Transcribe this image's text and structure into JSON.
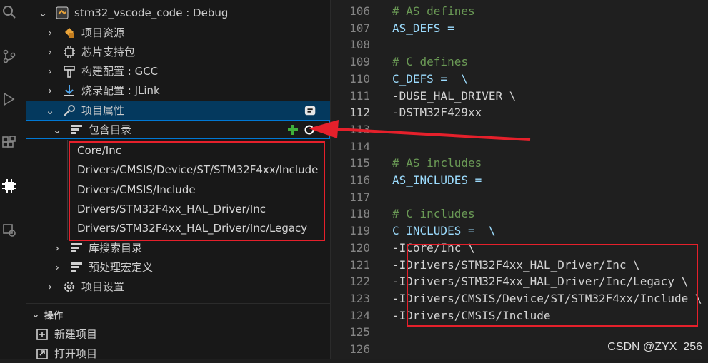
{
  "tree": {
    "project": "stm32_vscode_code : Debug",
    "items": [
      {
        "label": "项目资源",
        "icon": "resources-icon"
      },
      {
        "label": "芯片支持包",
        "icon": "chip-icon"
      },
      {
        "label": "构建配置 : GCC",
        "icon": "build-icon"
      },
      {
        "label": "烧录配置 : JLink",
        "icon": "download-icon"
      },
      {
        "label": "项目属性",
        "icon": "wrench-icon"
      }
    ],
    "include_dirs_label": "包含目录",
    "include_dirs": [
      "Core/Inc",
      "Drivers/CMSIS/Device/ST/STM32F4xx/Include",
      "Drivers/CMSIS/Include",
      "Drivers/STM32F4xx_HAL_Driver/Inc",
      "Drivers/STM32F4xx_HAL_Driver/Inc/Legacy"
    ],
    "lib_search_label": "库搜索目录",
    "preprocessor_label": "预处理宏定义",
    "project_settings_label": "项目设置"
  },
  "actions": {
    "title": "操作",
    "new_project": "新建项目",
    "open_project": "打开项目"
  },
  "editor": {
    "current_line": 112,
    "lines": [
      {
        "n": "106",
        "text": "# AS defines",
        "kind": "comment"
      },
      {
        "n": "107",
        "text": "AS_DEFS =",
        "kind": "var"
      },
      {
        "n": "108",
        "text": "",
        "kind": "plain"
      },
      {
        "n": "109",
        "text": "# C defines",
        "kind": "comment"
      },
      {
        "n": "110",
        "text": "C_DEFS =  \\",
        "kind": "var"
      },
      {
        "n": "111",
        "text": "-DUSE_HAL_DRIVER \\",
        "kind": "plain"
      },
      {
        "n": "112",
        "text": "-DSTM32F429xx",
        "kind": "plain"
      },
      {
        "n": "113",
        "text": "",
        "kind": "plain"
      },
      {
        "n": "114",
        "text": "",
        "kind": "plain"
      },
      {
        "n": "115",
        "text": "# AS includes",
        "kind": "comment"
      },
      {
        "n": "116",
        "text": "AS_INCLUDES =",
        "kind": "var"
      },
      {
        "n": "117",
        "text": "",
        "kind": "plain"
      },
      {
        "n": "118",
        "text": "# C includes",
        "kind": "comment"
      },
      {
        "n": "119",
        "text": "C_INCLUDES =  \\",
        "kind": "var"
      },
      {
        "n": "120",
        "text": "-ICore/Inc \\",
        "kind": "plain"
      },
      {
        "n": "121",
        "text": "-IDrivers/STM32F4xx_HAL_Driver/Inc \\",
        "kind": "plain"
      },
      {
        "n": "122",
        "text": "-IDrivers/STM32F4xx_HAL_Driver/Inc/Legacy \\",
        "kind": "plain"
      },
      {
        "n": "123",
        "text": "-IDrivers/CMSIS/Device/ST/STM32F4xx/Include \\",
        "kind": "plain"
      },
      {
        "n": "124",
        "text": "-IDrivers/CMSIS/Include",
        "kind": "plain"
      },
      {
        "n": "125",
        "text": "",
        "kind": "plain"
      },
      {
        "n": "126",
        "text": "",
        "kind": "plain"
      }
    ]
  },
  "watermark": "CSDN @ZYX_256",
  "colors": {
    "annotation_red": "#e5202b",
    "selection": "#04395e",
    "focus": "#0078d4"
  }
}
